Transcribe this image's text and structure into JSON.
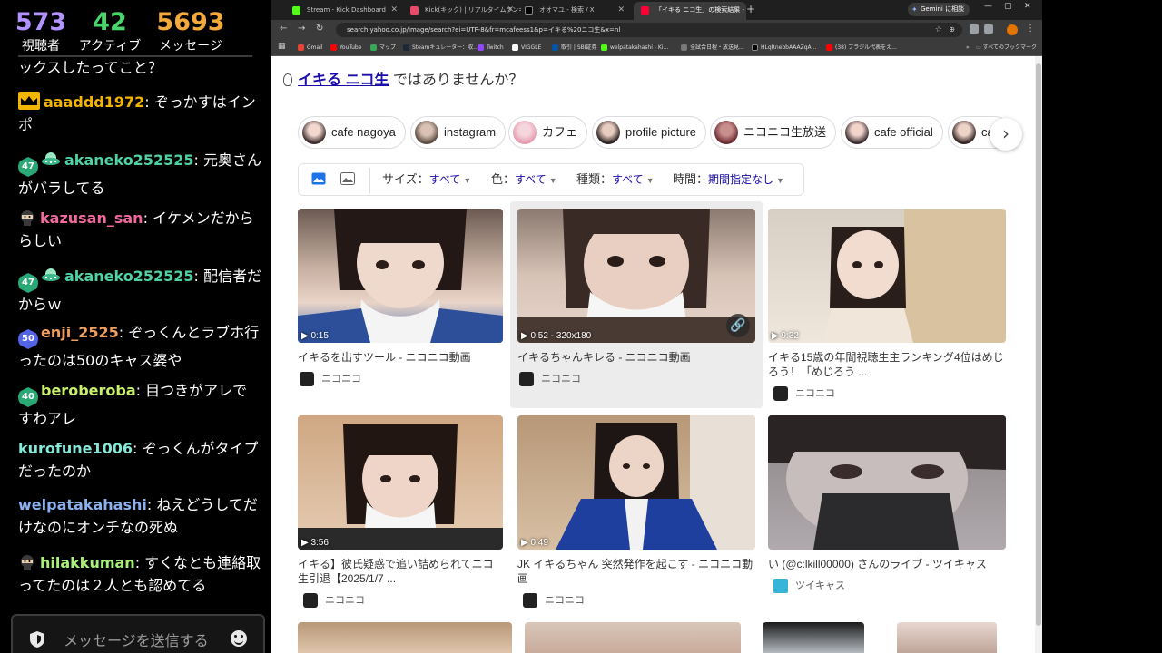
{
  "stats": {
    "viewers": {
      "value": "573",
      "label": "視聴者",
      "color": "#b194ff"
    },
    "active": {
      "value": "42",
      "label": "アクティブ",
      "color": "#4ad66d"
    },
    "messages": {
      "value": "5693",
      "label": "メッセージ",
      "color": "#f4a93b"
    }
  },
  "chat": {
    "messages": [
      {
        "user": "",
        "text": "ックスしたってこと？",
        "color": "#ffffff"
      },
      {
        "user": "aaaddd1972",
        "sep": ": ",
        "text": "ぞっかすはインポ",
        "color": "#f2b500",
        "badge": "crown-icon"
      },
      {
        "user": "akaneko252525",
        "sep": ": ",
        "text": "元奥さんがバラしてる",
        "color": "#4fd1a5",
        "level": "47",
        "badge": "ufo-icon"
      },
      {
        "user": "kazusan_san",
        "sep": ": ",
        "text": "イケメンだかららしい",
        "color": "#f2689c",
        "badge": "ninja-icon"
      },
      {
        "user": "akaneko252525",
        "sep": ": ",
        "text": "配信者だからｗ",
        "color": "#4fd1a5",
        "level": "47",
        "badge": "ufo-icon"
      },
      {
        "user": "enji_2525",
        "sep": ": ",
        "text": "ぞっくんとラブホ行ったのは50のキャス婆や",
        "color": "#f29f5c",
        "level": "50"
      },
      {
        "user": "beroberoba",
        "sep": ": ",
        "text": "目つきがアレですわアレ",
        "color": "#c9f06b",
        "level": "40"
      },
      {
        "user": "kurofune1006",
        "sep": ": ",
        "text": "ぞっくんがタイプだったのか",
        "color": "#86e8d8"
      },
      {
        "user": "welpatakahashi",
        "sep": ": ",
        "text": "ねえどうしてだけなのにオンチなの死ぬ",
        "color": "#8ab0f0"
      },
      {
        "user": "hilakkuman",
        "sep": ": ",
        "text": "すくなとも連絡取ってたのは２人とも認めてる",
        "color": "#a8f07a",
        "badge": "ninja-icon"
      }
    ],
    "input_placeholder": "メッセージを送信する"
  },
  "browser": {
    "tabs": [
      {
        "label": "Stream - Kick Dashboard",
        "fav": "#53fc18"
      },
      {
        "label": "Kick(キック) | リアルタイムランキング",
        "fav": "#e84b6a"
      },
      {
        "label": "オオマユ - 検索 / X",
        "fav": "#000000"
      },
      {
        "label": "「イキる ニコ生」の検索結果 - Yahoo",
        "fav": "#ff0033"
      }
    ],
    "gemini_label": "Gemini に相談",
    "url": "search.yahoo.co.jp/image/search?ei=UTF-8&fr=mcafeess1&p=イキる%20ニコ生&x=nl",
    "bookmarks": [
      {
        "label": "Gmail",
        "color": "#ea4335"
      },
      {
        "label": "YouTube",
        "color": "#ff0000"
      },
      {
        "label": "マップ",
        "color": "#34a853"
      },
      {
        "label": "Steamキュレーター：収...",
        "color": "#1b2838"
      },
      {
        "label": "Twitch",
        "color": "#9146ff"
      },
      {
        "label": "VIGGLE",
        "color": "#ffffff"
      },
      {
        "label": "取引 | SBI証券",
        "color": "#0055a5"
      },
      {
        "label": "welpatakahashi - Ki...",
        "color": "#53fc18"
      },
      {
        "label": "全試合日程・放送見...",
        "color": "#555555"
      },
      {
        "label": "HLqRnebbAAAZqA...",
        "color": "#000000"
      },
      {
        "label": "(38) ブラジル代表をえ...",
        "color": "#ff0000"
      }
    ],
    "bookmarks_all": "すべてのブックマーク"
  },
  "search": {
    "suggest_query": "イキる ニコ生",
    "suggest_suffix": " ではありませんか？",
    "chips": [
      "cafe nagoya",
      "instagram",
      "カフェ",
      "profile picture",
      "ニコニコ生放送",
      "cafe official",
      "ca"
    ],
    "filters": [
      {
        "label": "サイズ：",
        "value": "すべて"
      },
      {
        "label": "色：",
        "value": "すべて"
      },
      {
        "label": "種類：",
        "value": "すべて"
      },
      {
        "label": "時間：",
        "value": "期間指定なし"
      }
    ],
    "results": [
      {
        "title": "イキるを出すツール - ニコニコ動画",
        "source": "ニコニコ",
        "duration": "▶ 0:15"
      },
      {
        "title": "イキるちゃんキレる - ニコニコ動画",
        "source": "ニコニコ",
        "duration": "▶ 0:52 - 320x180"
      },
      {
        "title": "イキる15歳の年間視聴生主ランキング4位はめじろう！「めじろう ...",
        "source": "ニコニコ",
        "duration": "▶ 9:32"
      },
      {
        "title": "イキる】彼氏疑惑で追い詰められてニコ生引退【2025/1/7 ...",
        "source": "ニコニコ",
        "duration": "▶ 3:56"
      },
      {
        "title": "JK イキるちゃん 突然発作を起こす - ニコニコ動画",
        "source": "ニコニコ",
        "duration": "▶ 0:49"
      },
      {
        "title": "い (@c:lkill00000) さんのライブ - ツイキャス",
        "source": "ツイキャス",
        "duration": ""
      }
    ]
  }
}
